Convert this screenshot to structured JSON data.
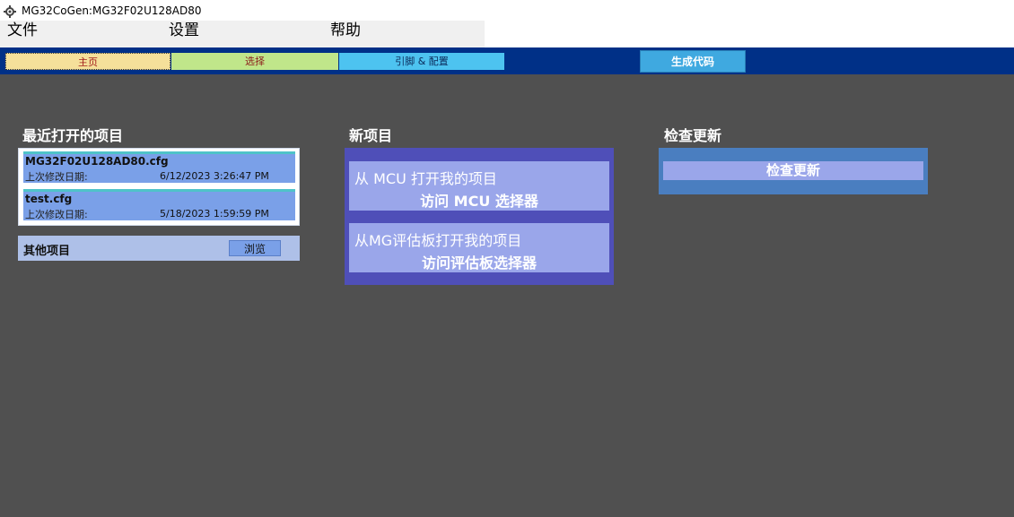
{
  "window": {
    "title": "MG32CoGen:MG32F02U128AD80"
  },
  "menu": {
    "items": [
      "文件",
      "设置",
      "帮助"
    ]
  },
  "tabs": {
    "home": "主页",
    "select": "选择",
    "pins": "引脚 & 配置",
    "generate": "生成代码"
  },
  "recent": {
    "title": "最近打开的项目",
    "items": [
      {
        "name": "MG32F02U128AD80.cfg",
        "mod_label": "上次修改日期:",
        "mod_date": "6/12/2023 3:26:47 PM"
      },
      {
        "name": "test.cfg",
        "mod_label": "上次修改日期:",
        "mod_date": "5/18/2023 1:59:59 PM"
      }
    ],
    "other_label": "其他项目",
    "browse_label": "浏览"
  },
  "new_project": {
    "title": "新项目",
    "cards": [
      {
        "line1": "从 MCU 打开我的项目",
        "line2": "访问 MCU 选择器"
      },
      {
        "line1": "从MG评估板打开我的项目",
        "line2": "访问评估板选择器"
      }
    ]
  },
  "update": {
    "title": "检查更新",
    "button": "检查更新"
  },
  "colors": {
    "toolbar": "#003087",
    "background": "#505050",
    "accent": "#4f4fb8"
  }
}
